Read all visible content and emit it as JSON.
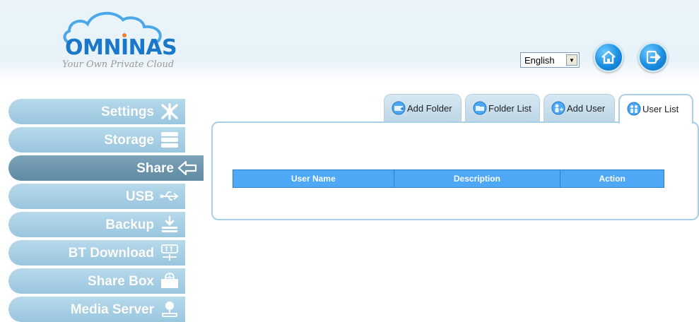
{
  "brand": {
    "name": "OMNINAS",
    "tagline": "Your Own Private Cloud",
    "accent": "#1a77c9"
  },
  "header": {
    "language": {
      "selected": "English",
      "arrow_glyph": "▼"
    },
    "home_icon": "home-icon",
    "logout_icon": "logout-icon"
  },
  "sidebar": {
    "items": [
      {
        "label": "Settings",
        "icon": "settings-icon"
      },
      {
        "label": "Storage",
        "icon": "storage-icon"
      },
      {
        "label": "Share",
        "icon": "share-arrow-icon",
        "active": true
      },
      {
        "label": "USB",
        "icon": "usb-icon"
      },
      {
        "label": "Backup",
        "icon": "backup-icon"
      },
      {
        "label": "BT Download",
        "icon": "bt-icon"
      },
      {
        "label": "Share Box",
        "icon": "share-box-icon"
      },
      {
        "label": "Media Server",
        "icon": "media-server-icon"
      }
    ]
  },
  "tabs": [
    {
      "label": "Add Folder",
      "icon": "add-folder-icon"
    },
    {
      "label": "Folder List",
      "icon": "folder-list-icon"
    },
    {
      "label": "Add User",
      "icon": "add-user-icon"
    },
    {
      "label": "User List",
      "icon": "user-list-icon",
      "active": true
    }
  ],
  "user_table": {
    "columns": [
      "User Name",
      "Description",
      "Action"
    ],
    "rows": []
  },
  "colors": {
    "sidebar_item": "#a9d0e6",
    "sidebar_active": "#6e97af",
    "table_header": "#4ea8f6",
    "panel_border": "#a8cfe6"
  }
}
